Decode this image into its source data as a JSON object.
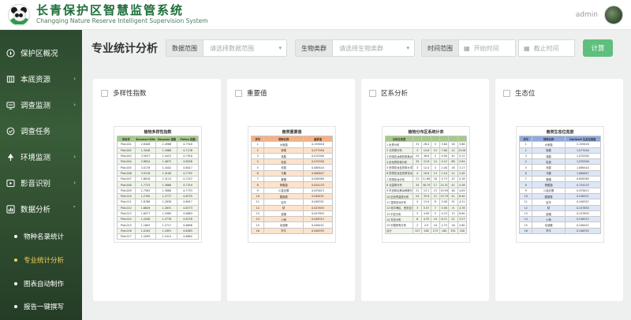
{
  "header": {
    "title_cn": "长青保护区智慧监管系统",
    "title_en": "Changqing Nature Reserve Intelligent Supervision System",
    "user": "admin"
  },
  "sidebar": {
    "items": [
      {
        "label": "保护区概况",
        "icon": "compass-icon"
      },
      {
        "label": "本底资源",
        "icon": "map-icon",
        "arrow": "›"
      },
      {
        "label": "调查监测",
        "icon": "monitor-icon",
        "arrow": "›"
      },
      {
        "label": "调查任务",
        "icon": "task-icon"
      },
      {
        "label": "环境监测",
        "icon": "tree-icon",
        "arrow": "›"
      },
      {
        "label": "影音识别",
        "icon": "media-icon",
        "arrow": "›"
      },
      {
        "label": "数据分析",
        "icon": "chart-icon",
        "arrow": "˅"
      }
    ],
    "subitems": [
      {
        "label": "物种名录统计",
        "active": false
      },
      {
        "label": "专业统计分析",
        "active": true
      },
      {
        "label": "图表自动制作",
        "active": false
      },
      {
        "label": "报告一键撰写",
        "active": false
      }
    ]
  },
  "toolbar": {
    "page_title": "专业统计分析",
    "scope_label": "数据范围",
    "scope_placeholder": "请选择数据范围",
    "species_label": "生物类群",
    "species_placeholder": "请选择生物类群",
    "time_label": "时间范围",
    "start_placeholder": "开始时间",
    "end_placeholder": "截止时间",
    "calc_label": "计算"
  },
  "cards": [
    {
      "label": "多样性指数",
      "thumb_title": "植物多样性指数",
      "headers": [
        "样地号",
        "Shannon-Wiener 指数",
        "Simpson 指数",
        "Pielou 指数"
      ],
      "rows": [
        [
          "Plot-001",
          "2.8408",
          "1.4968",
          "0.7518"
        ],
        [
          "Plot-002",
          "1.3048",
          "1.4968",
          "0.7138"
        ],
        [
          "Plot-003",
          "3.3037",
          "1.4423",
          "0.7918"
        ],
        [
          "Plot-004",
          "2.8844",
          "1.4675",
          "0.8038"
        ],
        [
          "Plot-005",
          "3.0178",
          "1.4402",
          "0.8017"
        ],
        [
          "Plot-006",
          "3.9218",
          "1.4100",
          "0.7792"
        ],
        [
          "Plot-007",
          "1.8818",
          "1.3115",
          "0.7257"
        ],
        [
          "Plot-008",
          "1.7723",
          "1.3868",
          "0.7319"
        ],
        [
          "Plot-009",
          "1.7583",
          "1.3888",
          "0.7753"
        ],
        [
          "Plot-010",
          "1.2700",
          "1.2772",
          "0.6735"
        ],
        [
          "Plot-011",
          "1.6768",
          "1.2838",
          "0.6917"
        ],
        [
          "Plot-012",
          "1.6649",
          "1.2631",
          "0.6773"
        ],
        [
          "Plot-013",
          "1.6977",
          "1.2985",
          "0.6683"
        ],
        [
          "Plot-014",
          "1.2048",
          "1.2776",
          "0.6728"
        ],
        [
          "Plot-015",
          "1.1805",
          "1.2717",
          "0.6696"
        ],
        [
          "Plot-016",
          "1.0109",
          "1.1891",
          "0.6563"
        ],
        [
          "Plot-017",
          "1.2099",
          "1.2414",
          "0.6692"
        ]
      ]
    },
    {
      "label": "重要值",
      "thumb_title": "兽类重要值",
      "headers": [
        "序号",
        "物种名称",
        "重要值"
      ],
      "rows": [
        [
          "1",
          "大熊猫",
          "0.155618"
        ],
        [
          "2",
          "猕猴",
          "0.077050"
        ],
        [
          "3",
          "林麝",
          "0.070300"
        ],
        [
          "4",
          "松鼠",
          "0.070300"
        ],
        [
          "5",
          "赤狐",
          "0.069444"
        ],
        [
          "6",
          "马鹿",
          "0.060847"
        ],
        [
          "7",
          "獾猪",
          "0.058389"
        ],
        [
          "8",
          "黄腹鼬",
          "0.054233"
        ],
        [
          "9",
          "川金丝猴",
          "0.053613"
        ],
        [
          "10",
          "藏酋猴",
          "0.048451"
        ],
        [
          "11",
          "岩羊",
          "0.048351"
        ],
        [
          "12",
          "豺",
          "0.047655"
        ],
        [
          "13",
          "豪猪",
          "0.047803"
        ],
        [
          "14",
          "小熊",
          "0.046312"
        ],
        [
          "15",
          "毛冠鹿",
          "0.046451"
        ],
        [
          "16",
          "羚牛",
          "0.046355"
        ]
      ]
    },
    {
      "label": "区系分析",
      "thumb_title": "植物分布区系统计表",
      "headers": [
        "分布区类型",
        "",
        "",
        "",
        "",
        "",
        ""
      ],
      "rows": [
        [
          "1 世界分布",
          "31",
          "28.0",
          "5",
          "3.80",
          "28",
          "3.68"
        ],
        [
          "2 泛热带分布",
          "3",
          "14.8",
          "15",
          "7.80",
          "12",
          "13.00"
        ],
        [
          "3 热带亚洲和热带美洲间断分布",
          "24",
          "38.8",
          "3",
          "0.90",
          "45",
          "5.12"
        ],
        [
          "4 旧世界热带分布",
          "34",
          "12.8",
          "14",
          "4.12",
          "88",
          "5.84"
        ],
        [
          "5 热带亚洲至热带大洋洲分布",
          "3",
          "12.0",
          "3",
          "2.00",
          "18",
          "3.17"
        ],
        [
          "6 热带亚洲至热带非洲分布",
          "4",
          "18.8",
          "13",
          "2.10",
          "21",
          "2.40"
        ],
        [
          "7 热带亚洲分布",
          "21",
          "11.88",
          "18",
          "4.73",
          "43",
          "4.18"
        ],
        [
          "8 北温带分布",
          "34",
          "38.79",
          "17",
          "15.31",
          "41",
          "5.38"
        ],
        [
          "9 东亚和北美洲间断分布",
          "21",
          "13.1",
          "13",
          "19.59",
          "46",
          "4.09"
        ],
        [
          "10 旧世界温带分布",
          "24",
          "35.8",
          "12",
          "13.79",
          "41",
          "6.40"
        ],
        [
          "11 温带亚洲分布",
          "4",
          "13.0",
          "8",
          "3.48",
          "31",
          "4.31"
        ],
        [
          "12 地中海区、西亚至中亚分布",
          "3",
          "5.57",
          "7",
          "3.90",
          "8",
          "4.78"
        ],
        [
          "13 中亚分布",
          "3",
          "4.09",
          "5",
          "4.23",
          "13",
          "6.80"
        ],
        [
          "14 东亚分布",
          "6",
          "4.33",
          "19",
          "6.71",
          "21",
          "3.27"
        ],
        [
          "15 中国特有分布",
          "2",
          "4.9",
          "10",
          "4.75",
          "16",
          "4.60"
        ],
        [
          "合计",
          "127",
          "100",
          "173",
          "100",
          "351",
          "100"
        ]
      ]
    },
    {
      "label": "生态位",
      "thumb_title": "兽类生态位宽度",
      "headers": [
        "序号",
        "物种名称",
        "Hurlbert 生态位宽度"
      ],
      "rows": [
        [
          "1",
          "大熊猫",
          "2.155618"
        ],
        [
          "2",
          "猕猴",
          "1.077050"
        ],
        [
          "3",
          "林麝",
          "1.070300"
        ],
        [
          "4",
          "松鼠",
          "1.070300"
        ],
        [
          "5",
          "赤狐",
          "1.069444"
        ],
        [
          "6",
          "马鹿",
          "1.060847"
        ],
        [
          "7",
          "獾猪",
          "0.858389"
        ],
        [
          "8",
          "黄腹鼬",
          "0.754233"
        ],
        [
          "9",
          "川金丝猴",
          "0.553613"
        ],
        [
          "10",
          "藏酋猴",
          "0.248451"
        ],
        [
          "11",
          "岩羊",
          "0.248351"
        ],
        [
          "12",
          "豺",
          "0.247655"
        ],
        [
          "13",
          "豪猪",
          "0.247803"
        ],
        [
          "14",
          "小熊",
          "0.246312"
        ],
        [
          "15",
          "毛冠鹿",
          "0.246451"
        ],
        [
          "16",
          "羚牛",
          "0.246355"
        ]
      ]
    }
  ]
}
